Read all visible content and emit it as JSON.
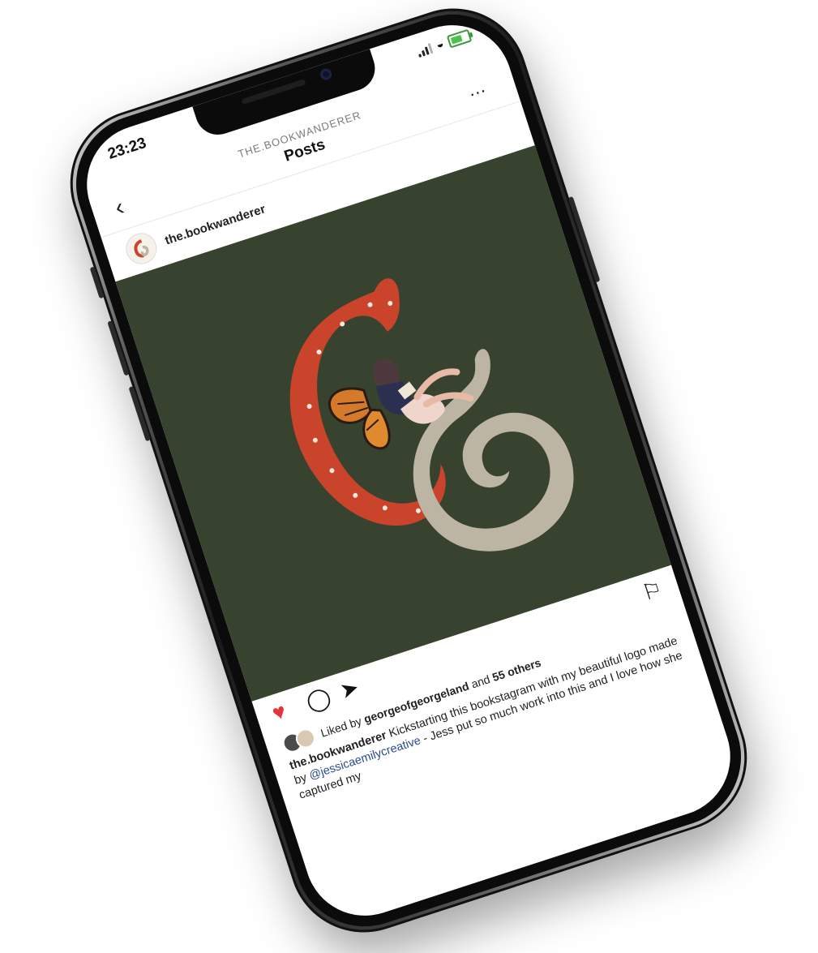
{
  "status_bar": {
    "time": "23:23"
  },
  "header": {
    "account_caption": "THE.BOOKWANDERER",
    "title": "Posts",
    "back_icon": "chevron-left-icon",
    "more_icon": "more-horizontal-icon"
  },
  "post": {
    "username": "the.bookwanderer",
    "image_colors": {
      "background": "#38432f",
      "letter_c": "#c9442b",
      "letter_g": "#bdb5a3"
    },
    "likes": {
      "prefix": "Liked by",
      "user": "georgeofgeorgeland",
      "conjunction": "and",
      "others": "55 others"
    },
    "caption": {
      "user": "the.bookwanderer",
      "text_before": "Kickstarting this bookstagram with my beautiful logo made by",
      "mention": "@jessicaemilycreative",
      "text_after": "- Jess put so much work into this and I love how she captured my"
    }
  },
  "colors": {
    "like_active": "#e0363b",
    "mention": "#2a4b8d"
  }
}
